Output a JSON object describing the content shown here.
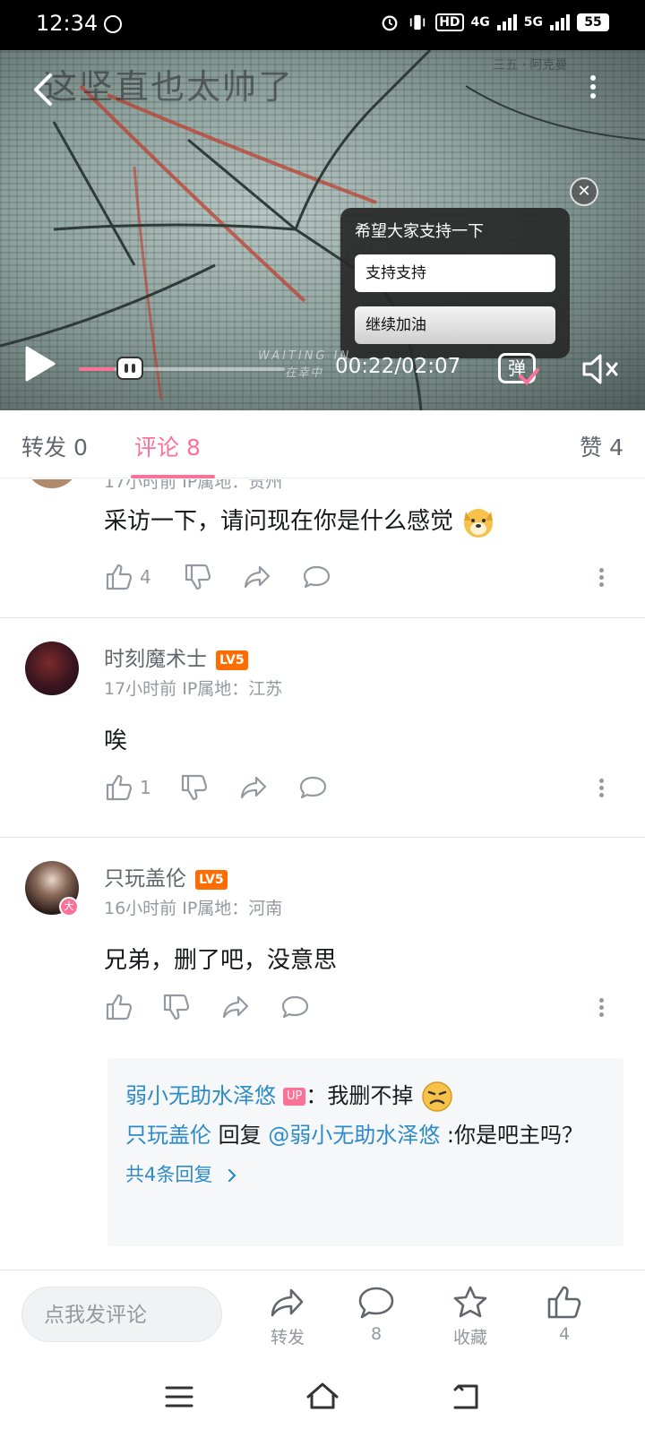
{
  "status_bar": {
    "time": "12:34",
    "network_hd": "HD",
    "network_4g": "4G",
    "network_5g": "5G",
    "battery": "55"
  },
  "video": {
    "overlay_title": "这坚直也太帅了",
    "watermark_text": "WAITING IN",
    "watermark_sub": "在幸中",
    "corner_watermark": "三五 · 阿克曼",
    "poll_title": "希望大家支持一下",
    "poll_option_1": "支持支持",
    "poll_option_2": "继续加油",
    "time_display": "00:22/02:07",
    "progress_fraction": 0.173,
    "danmaku_label": "弹",
    "accent_color": "#fb7299"
  },
  "tabs": {
    "forward": "转发 0",
    "comments": "评论 8",
    "likes": "赞 4"
  },
  "comments": [
    {
      "meta_partial": "17小时前  IP属地：贵州",
      "text": "采访一下，请问现在你是什么感觉",
      "emoji": "dog-face",
      "likes": "4"
    },
    {
      "username": "时刻魔术士",
      "level": "LV5",
      "meta": "17小时前  IP属地：江苏",
      "text": "唉",
      "likes": "1"
    },
    {
      "username": "只玩盖伦",
      "level": "LV5",
      "avatar_badge": "大",
      "meta": "16小时前  IP属地：河南",
      "text": "兄弟，删了吧，没意思",
      "likes": ""
    }
  ],
  "reply_box": {
    "r1_name": "弱小无助水泽悠",
    "r1_badge": "UP",
    "r1_text": "：我删不掉",
    "r2_name": "只玩盖伦",
    "r2_reply_word": " 回复 ",
    "r2_mention": "@弱小无助水泽悠",
    "r2_text": " :你是吧主吗？",
    "more": "共4条回复"
  },
  "bottom_bar": {
    "input_placeholder": "点我发评论",
    "forward_label": "转发",
    "comment_count": "8",
    "favorite_label": "收藏",
    "like_count": "4"
  }
}
